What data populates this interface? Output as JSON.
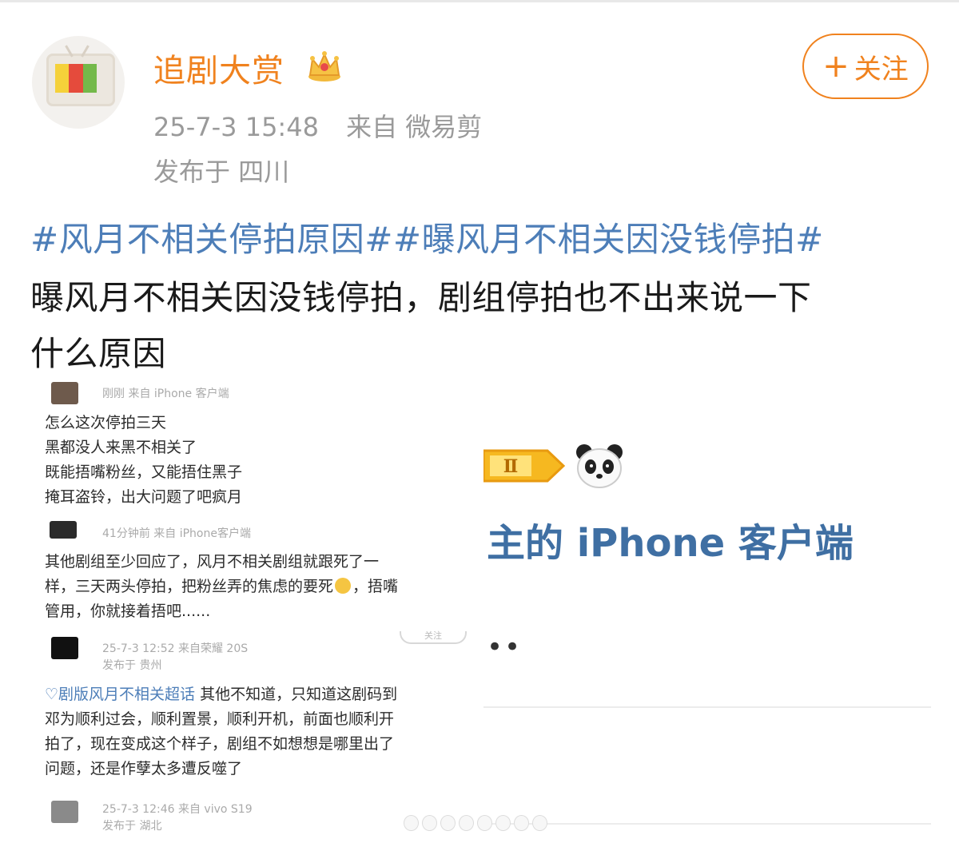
{
  "post": {
    "username": "追剧大赏",
    "timestamp": "25-7-3 15:48",
    "source": "来自 微易剪",
    "location": "发布于 四川",
    "follow_label": "关注",
    "follow_plus": "+",
    "hashtag_1": "#风月不相关停拍原因#",
    "hashtag_2": "#曝风月不相关因没钱停拍#",
    "text_line_1": "曝风月不相关因没钱停拍，剧组停拍也不出来说一下",
    "text_line_2": "什么原因",
    "accent_color": "#f0821e",
    "link_color": "#4d7eb8"
  },
  "screenshot": {
    "comments": [
      {
        "meta": "刚刚  来自 iPhone 客户端",
        "lines": [
          "怎么这次停拍三天",
          "黑都没人来黑不相关了",
          "既能捂嘴粉丝，又能捂住黑子",
          "掩耳盗铃，出大问题了吧疯月"
        ]
      },
      {
        "meta": "41分钟前  来自 iPhone客户端",
        "lines": [
          "其他剧组至少回应了，风月不相关剧组就跟死了一",
          "样，三天两头停拍，把粉丝弄的焦虑的要死",
          "，捂嘴",
          "管用，你就接着捂吧......"
        ]
      },
      {
        "meta": "25-7-3 12:52  来自荣耀 20S",
        "location": "发布于 贵州",
        "topic": "剧版风月不相关超话",
        "lines": [
          "其他不知道，只知道这剧码到",
          "邓为顺利过会，顺利置景，顺利开机，前面也顺利开",
          "拍了，现在变成这个样子，剧组不如想想是哪里出了",
          "问题，还是作孽太多遭反噬了"
        ]
      },
      {
        "meta": "25-7-3 12:46  来自 vivo S19",
        "location": "发布于 湖北"
      }
    ],
    "right": {
      "level": "Ⅱ",
      "client_text": "主的 iPhone 客户端",
      "dots": "••"
    },
    "pill": "关注"
  }
}
